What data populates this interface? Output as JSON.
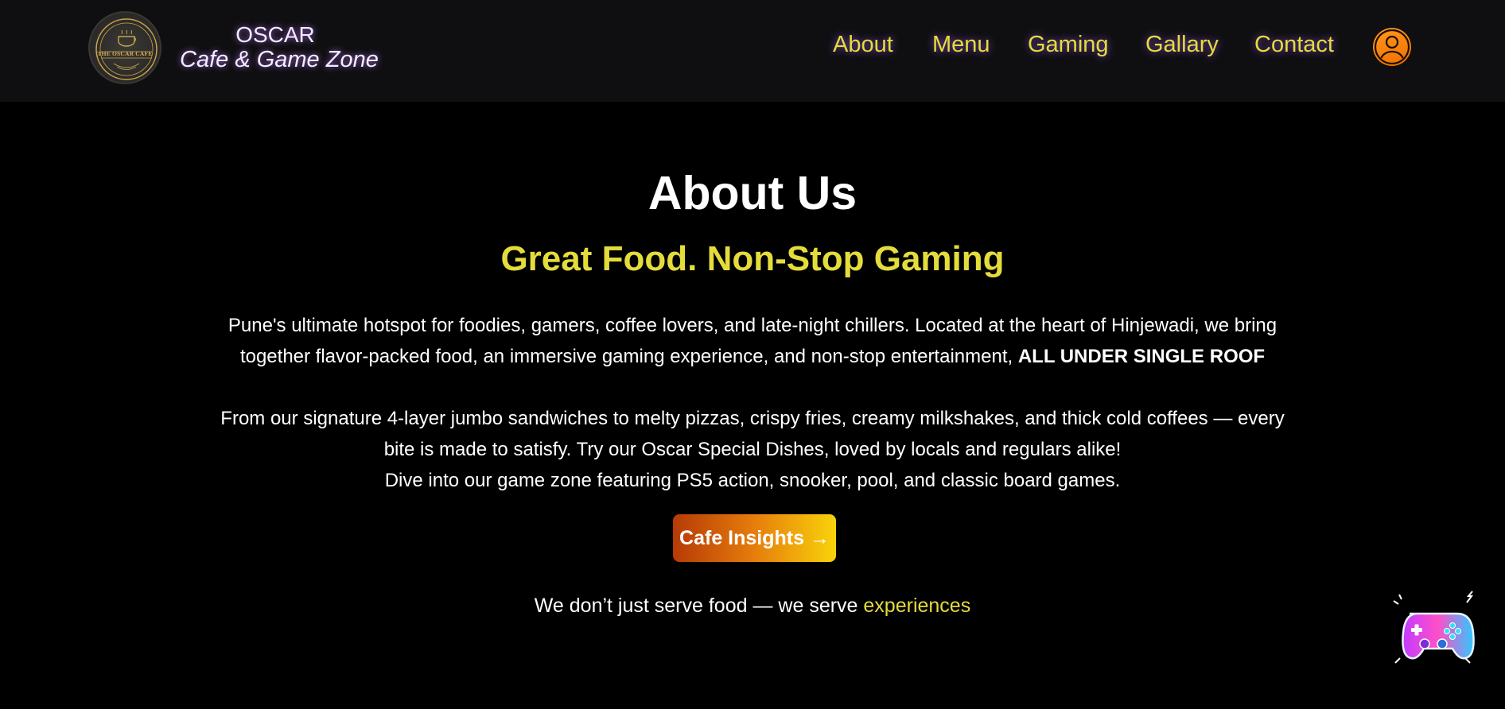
{
  "header": {
    "logo_text": "THE OSCAR CAFE",
    "brand_name": "OSCAR",
    "brand_tagline": "Cafe & Game Zone",
    "nav": [
      {
        "label": "About"
      },
      {
        "label": "Menu"
      },
      {
        "label": "Gaming"
      },
      {
        "label": "Gallary"
      },
      {
        "label": "Contact"
      }
    ],
    "profile_icon": "user-icon"
  },
  "about": {
    "title": "About Us",
    "subtitle": "Great Food. Non-Stop Gaming",
    "paragraph1": "Pune's ultimate hotspot for foodies, gamers, coffee lovers, and late-night chillers. Located at the heart of Hinjewadi, we bring together flavor-packed food, an immersive gaming experience, and non-stop entertainment,",
    "paragraph1_bold": "ALL UNDER SINGLE ROOF",
    "paragraph2": "From our signature 4-layer jumbo sandwiches to melty pizzas, crispy fries, creamy milkshakes, and thick cold coffees — every bite is made to satisfy. Try our Oscar Special Dishes, loved by locals and regulars alike!",
    "paragraph3": "Dive into our game zone featuring PS5 action, snooker, pool, and classic board games.",
    "cta_label": "Cafe Insights →",
    "footer_text": "We don’t just serve food — we serve",
    "footer_accent": "experiences"
  },
  "floating": {
    "icon": "gamepad-icon"
  },
  "colors": {
    "accent_yellow": "#e4dc3b",
    "background": "#000000",
    "navbar": "#0f0f11",
    "profile_orange": "#f07a00",
    "cta_start": "#b63a06",
    "cta_end": "#f9d30a"
  }
}
